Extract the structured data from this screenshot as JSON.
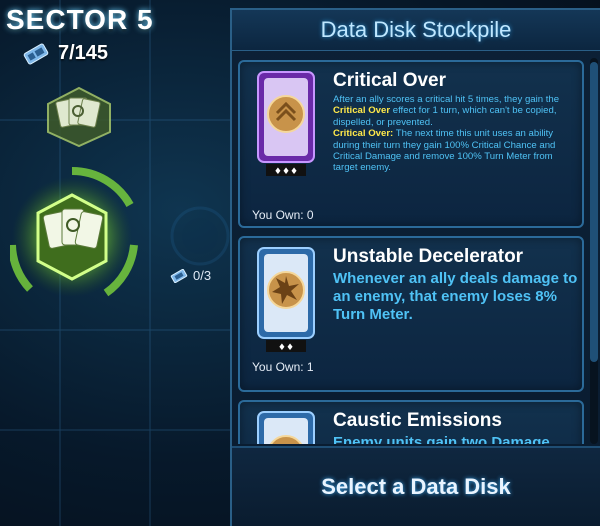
{
  "map": {
    "sector_title": "SECTOR 5",
    "disk_count": "7/145",
    "node_counter": "0/3"
  },
  "panel": {
    "title": "Data Disk Stockpile",
    "cards": [
      {
        "name": "Critical Over",
        "desc_part1": "After an ally scores a critical hit 5 times, they gain the ",
        "desc_highlight": "Critical Over",
        "desc_part2": " effect for 1 turn, which can't be copied, dispelled, or prevented.",
        "effect_label": "Critical Over:",
        "effect_text": " The next time this unit uses an ability during their turn they gain 100% Critical Chance and Critical Damage and remove 100% Turn Meter from target enemy.",
        "owned": "You Own: 0",
        "tier": "♦♦♦",
        "color": "#9b3fe0"
      },
      {
        "name": "Unstable Decelerator",
        "desc": "Whenever an ally deals damage to an enemy, that enemy loses 8% Turn Meter.",
        "owned": "You Own: 1",
        "tier": "♦♦",
        "color": "#3f9be0"
      },
      {
        "name": "Caustic Emissions",
        "desc": "Enemy units gain two Damage",
        "color": "#3f9be0"
      }
    ],
    "footer_label": "Select a Data Disk"
  },
  "colors": {
    "accent_blue": "#4fc2f5",
    "highlight_yellow": "#ffe94a",
    "map_green": "#8fe04a"
  }
}
